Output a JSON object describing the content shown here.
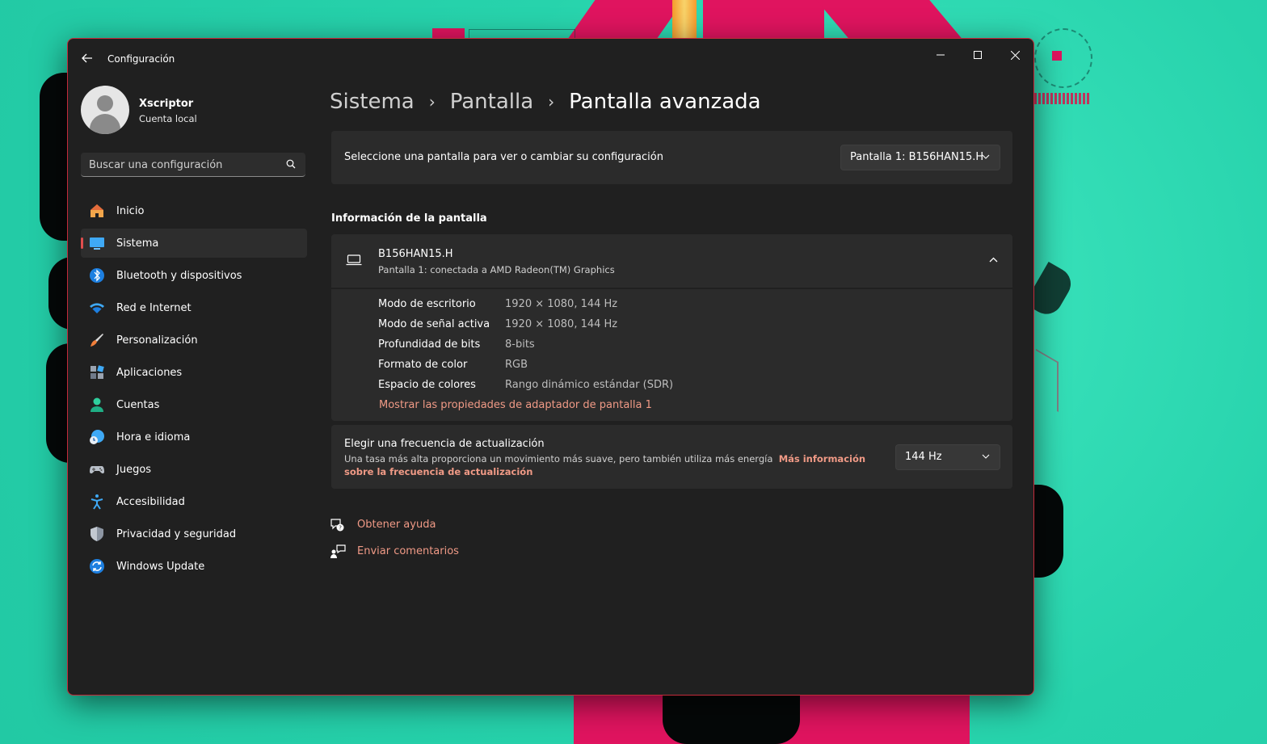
{
  "app": {
    "title": "Configuración"
  },
  "profile": {
    "name": "Xscriptor",
    "account_type": "Cuenta local"
  },
  "search": {
    "placeholder": "Buscar una configuración"
  },
  "sidebar": {
    "items": [
      {
        "label": "Inicio",
        "icon": "home-icon",
        "active": false
      },
      {
        "label": "Sistema",
        "icon": "monitor-icon",
        "active": true
      },
      {
        "label": "Bluetooth y dispositivos",
        "icon": "bluetooth-icon",
        "active": false
      },
      {
        "label": "Red e Internet",
        "icon": "wifi-icon",
        "active": false
      },
      {
        "label": "Personalización",
        "icon": "brush-icon",
        "active": false
      },
      {
        "label": "Aplicaciones",
        "icon": "apps-icon",
        "active": false
      },
      {
        "label": "Cuentas",
        "icon": "person-icon",
        "active": false
      },
      {
        "label": "Hora e idioma",
        "icon": "globe-clock-icon",
        "active": false
      },
      {
        "label": "Juegos",
        "icon": "gamepad-icon",
        "active": false
      },
      {
        "label": "Accesibilidad",
        "icon": "accessibility-icon",
        "active": false
      },
      {
        "label": "Privacidad y seguridad",
        "icon": "shield-icon",
        "active": false
      },
      {
        "label": "Windows Update",
        "icon": "update-icon",
        "active": false
      }
    ]
  },
  "breadcrumb": {
    "part1": "Sistema",
    "part2": "Pantalla",
    "current": "Pantalla avanzada"
  },
  "select_display": {
    "label": "Seleccione una pantalla para ver o cambiar su configuración",
    "value": "Pantalla 1: B156HAN15.H"
  },
  "display_info": {
    "section_title": "Información de la pantalla",
    "name": "B156HAN15.H",
    "subtitle": "Pantalla 1: conectada a AMD Radeon(TM) Graphics",
    "rows": [
      {
        "key": "Modo de escritorio",
        "value": "1920 × 1080, 144 Hz"
      },
      {
        "key": "Modo de señal activa",
        "value": "1920 × 1080, 144 Hz"
      },
      {
        "key": "Profundidad de bits",
        "value": "8-bits"
      },
      {
        "key": "Formato de color",
        "value": "RGB"
      },
      {
        "key": "Espacio de colores",
        "value": "Rango dinámico estándar (SDR)"
      }
    ],
    "adapter_link": "Mostrar las propiedades de adaptador de pantalla 1"
  },
  "refresh": {
    "title": "Elegir una frecuencia de actualización",
    "description": "Una tasa más alta proporciona un movimiento más suave, pero también utiliza más energía",
    "link": "Más información sobre la frecuencia de actualización",
    "value": "144 Hz"
  },
  "help": {
    "get_help": "Obtener ayuda",
    "feedback": "Enviar comentarios"
  },
  "colors": {
    "accent": "#f09a86",
    "window_bg": "#202020",
    "card_bg": "#2b2b2b",
    "window_border": "#c42b3b"
  }
}
